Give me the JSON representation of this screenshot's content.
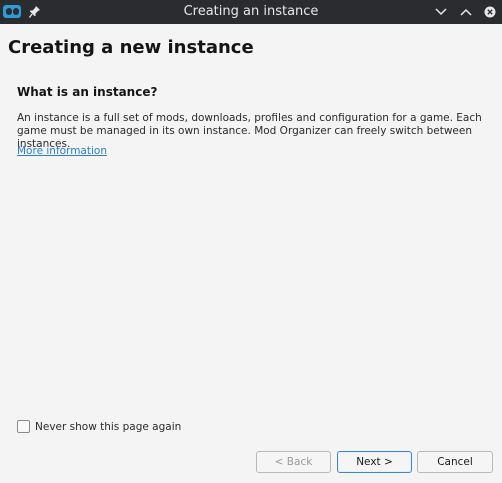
{
  "window": {
    "title": "Creating an instance"
  },
  "page": {
    "title": "Creating a new instance",
    "section_heading": "What is an instance?",
    "description": "An instance is a full set of mods, downloads, profiles and configuration for a game. Each game must be managed in its own instance. Mod Organizer can freely switch between instances.",
    "more_link": "More information"
  },
  "options": {
    "never_show_label": "Never show this page again",
    "never_show_checked": false
  },
  "buttons": {
    "back": "< Back",
    "next": "Next >",
    "cancel": "Cancel"
  },
  "colors": {
    "titlebar": "#2a2c2f",
    "background": "#f4f4f4",
    "link": "#2a7fd0",
    "accent": "#3a87d0"
  }
}
